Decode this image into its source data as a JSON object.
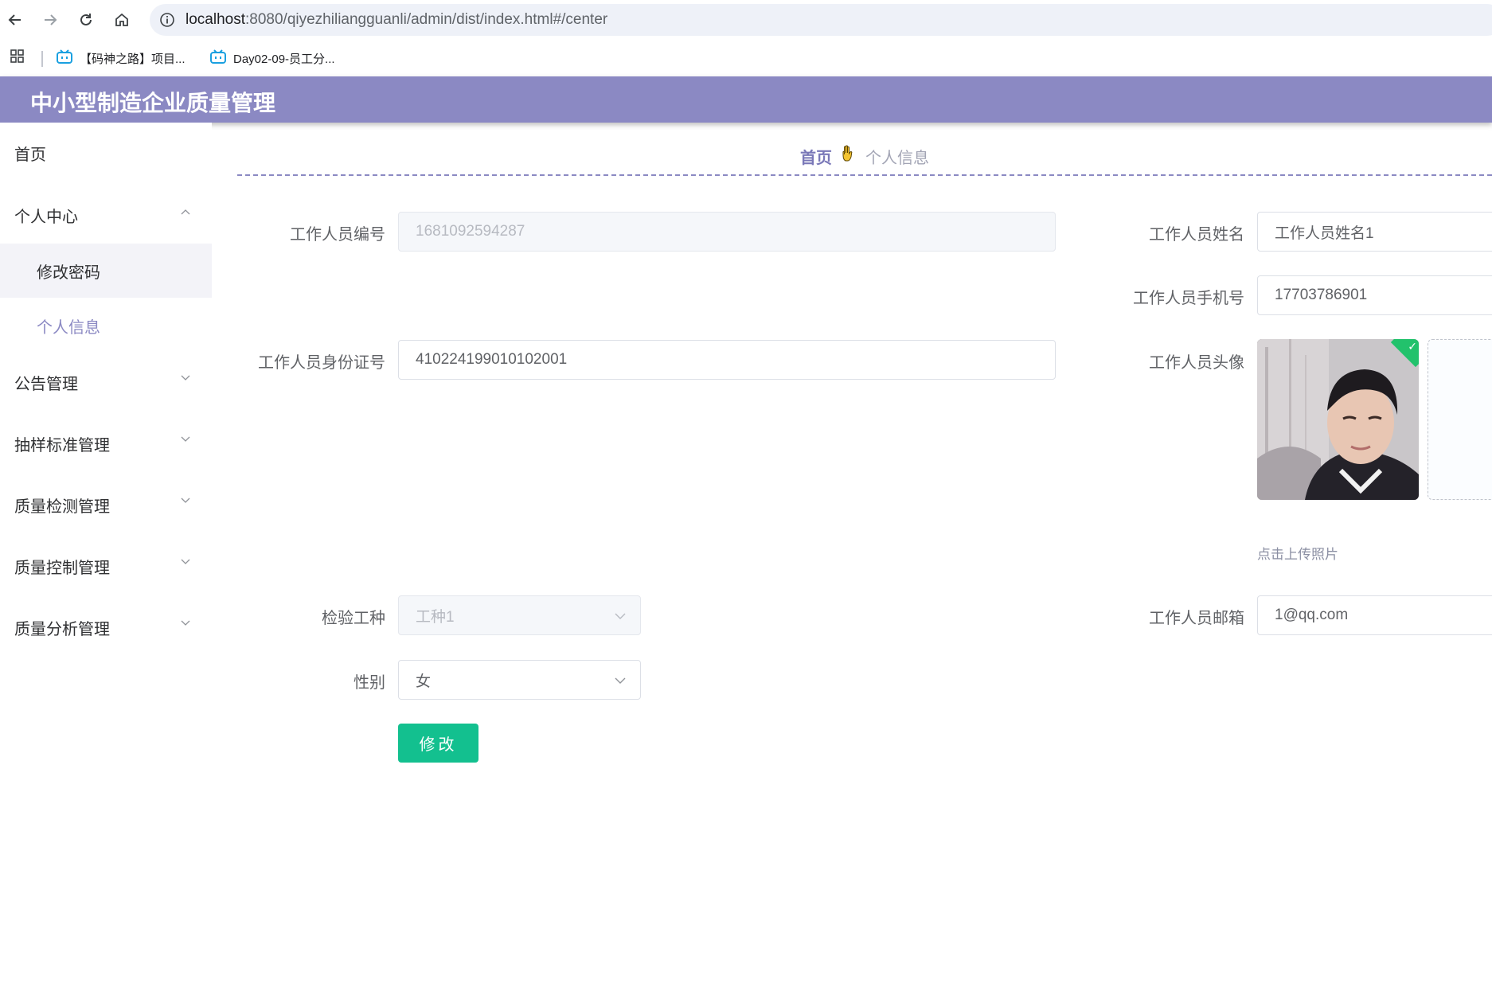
{
  "browser": {
    "url_host": "localhost",
    "url_path": ":8080/qiyezhiliangguanli/admin/dist/index.html#/center",
    "bookmarks": [
      {
        "label": "【码神之路】项目..."
      },
      {
        "label": "Day02-09-员工分..."
      }
    ]
  },
  "app": {
    "title": "中小型制造企业质量管理"
  },
  "sidebar": {
    "items": [
      {
        "label": "首页"
      },
      {
        "label": "个人中心",
        "expanded": true,
        "children": [
          {
            "label": "修改密码"
          },
          {
            "label": "个人信息",
            "active": true
          }
        ]
      },
      {
        "label": "公告管理"
      },
      {
        "label": "抽样标准管理"
      },
      {
        "label": "质量检测管理"
      },
      {
        "label": "质量控制管理"
      },
      {
        "label": "质量分析管理"
      }
    ]
  },
  "breadcrumb": {
    "home": "首页",
    "separator_icon": "hand-icon",
    "current": "个人信息"
  },
  "form": {
    "staff_no_label": "工作人员编号",
    "staff_no_value": "1681092594287",
    "staff_name_label": "工作人员姓名",
    "staff_name_value": "工作人员姓名1",
    "phone_label": "工作人员手机号",
    "phone_value": "17703786901",
    "id_card_label": "工作人员身份证号",
    "id_card_value": "410224199010102001",
    "avatar_label": "工作人员头像",
    "upload_hint": "点击上传照片",
    "work_type_label": "检验工种",
    "work_type_value": "工种1",
    "email_label": "工作人员邮箱",
    "email_value": "1@qq.com",
    "gender_label": "性别",
    "gender_value": "女",
    "submit_label": "修改"
  },
  "colors": {
    "header": "#8b89c3",
    "submit": "#13c08f",
    "active_menu": "#8b89c3"
  }
}
